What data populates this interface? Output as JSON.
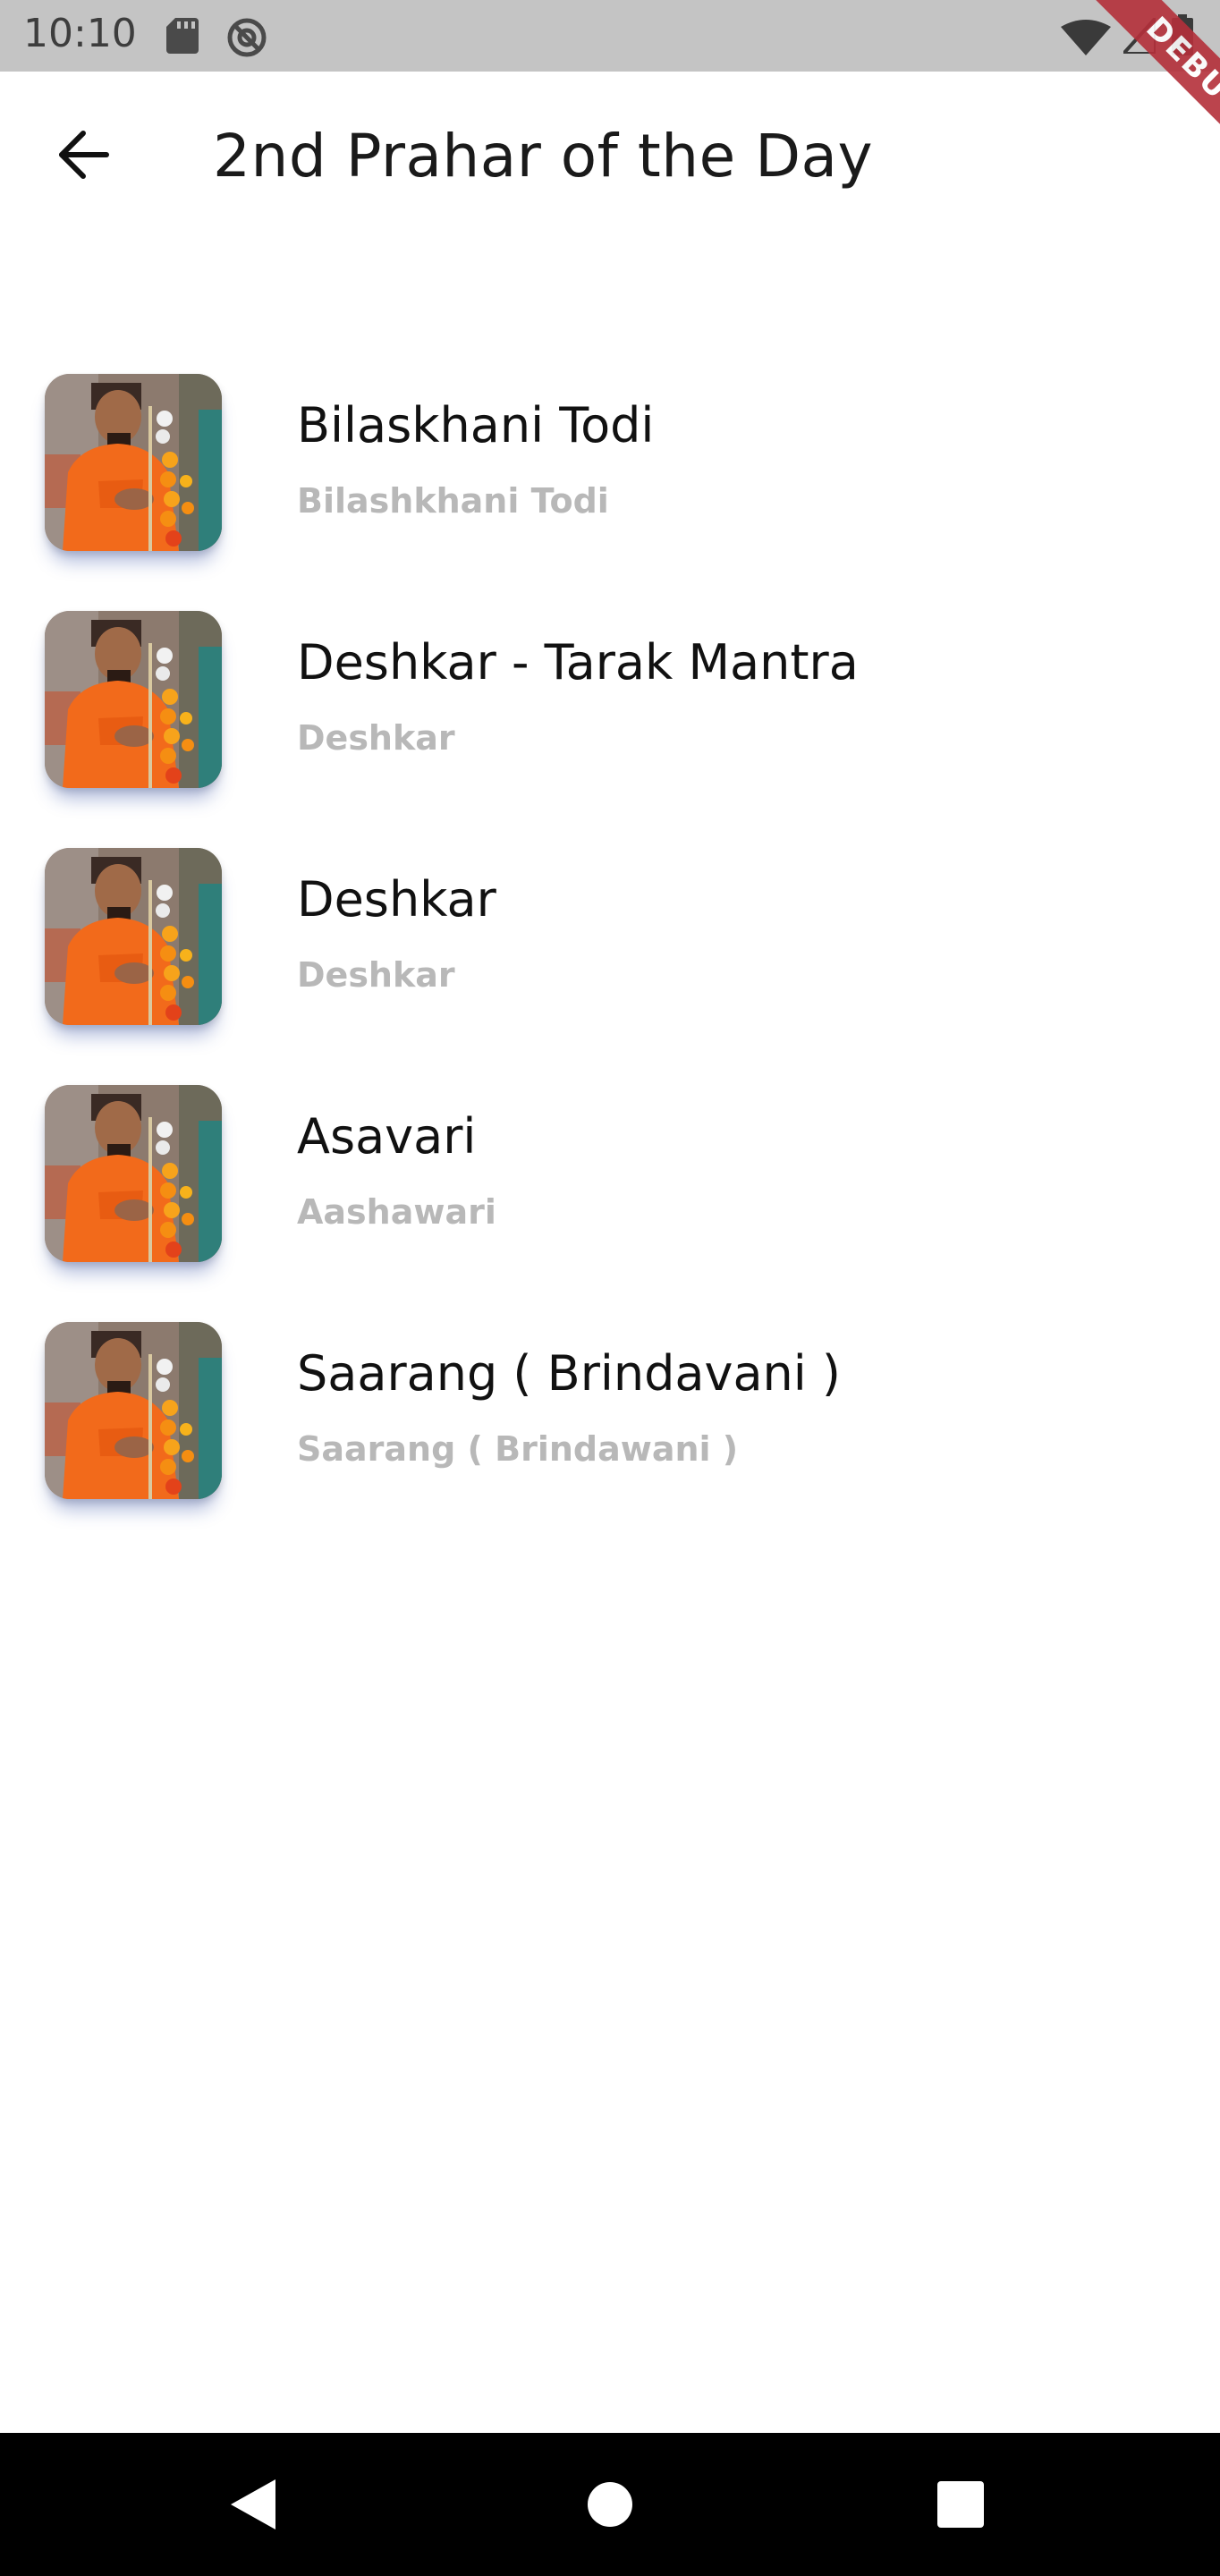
{
  "status_bar": {
    "time": "10:10",
    "icons": [
      "sd-card-icon",
      "sync-icon",
      "wifi-icon",
      "signal-icon",
      "battery-icon"
    ]
  },
  "debug_banner": {
    "label": "DEBUG",
    "color": "#b4303a"
  },
  "app_bar": {
    "title": "2nd Prahar of the Day",
    "back_icon": "arrow-back-icon"
  },
  "songs": [
    {
      "title": "Bilaskhani Todi",
      "subtitle": "Bilashkhani Todi"
    },
    {
      "title": "Deshkar - Tarak Mantra",
      "subtitle": "Deshkar"
    },
    {
      "title": "Deshkar",
      "subtitle": "Deshkar"
    },
    {
      "title": "Asavari",
      "subtitle": "Aashawari"
    },
    {
      "title": "Saarang ( Brindavani )",
      "subtitle": "Saarang ( Brindawani )"
    }
  ],
  "nav_bar": {
    "icons": [
      "nav-back-icon",
      "nav-home-icon",
      "nav-recents-icon"
    ]
  },
  "colors": {
    "status_bar_bg": "#c4c4c4",
    "title_text": "#111111",
    "subtitle_text": "#b8b8b8",
    "thumbnail_accent": "#f26a1b",
    "nav_bar_bg": "#000000"
  }
}
